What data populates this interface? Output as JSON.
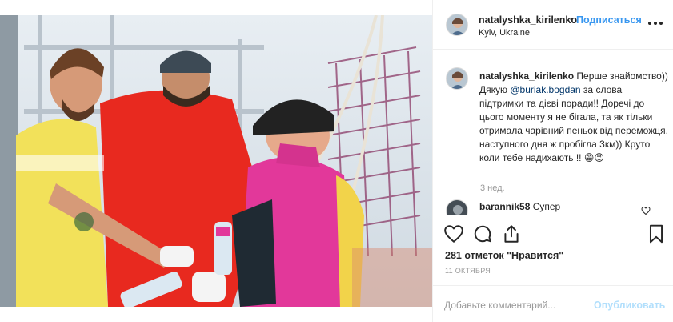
{
  "post": {
    "username": "natalyshka_kirilenko",
    "separator": "•",
    "follow_label": "Подписаться",
    "location": "Kyiv, Ukraine",
    "more_icon": "more-horizontal-icon"
  },
  "caption": {
    "username": "natalyshka_kirilenko",
    "text_before_mention": "Перше знайомство)) Дякую ",
    "mention": "@buriak.bogdan",
    "text_after_mention": " за слова підтримки та дієві поради!! Доречі до цього моменту я не бігала, та як тільки отримала чарівний пеньок від переможця, наступного дня ж пробігла 3км)) Круто коли тебе надихають !! 😁😉",
    "time": "3 нед."
  },
  "comments": [
    {
      "username": "barannik58",
      "text": "Супер"
    }
  ],
  "actions": {
    "like_icon": "heart-icon",
    "comment_icon": "comment-icon",
    "share_icon": "share-icon",
    "save_icon": "bookmark-icon"
  },
  "likes_text": "281 отметок \"Нравится\"",
  "date": "11 октября",
  "composer": {
    "placeholder": "Добавьте комментарий...",
    "publish_label": "Опубликовать"
  },
  "colors": {
    "link_blue": "#3897f0",
    "publish_disabled": "#b2dffc",
    "border": "#efefef"
  }
}
